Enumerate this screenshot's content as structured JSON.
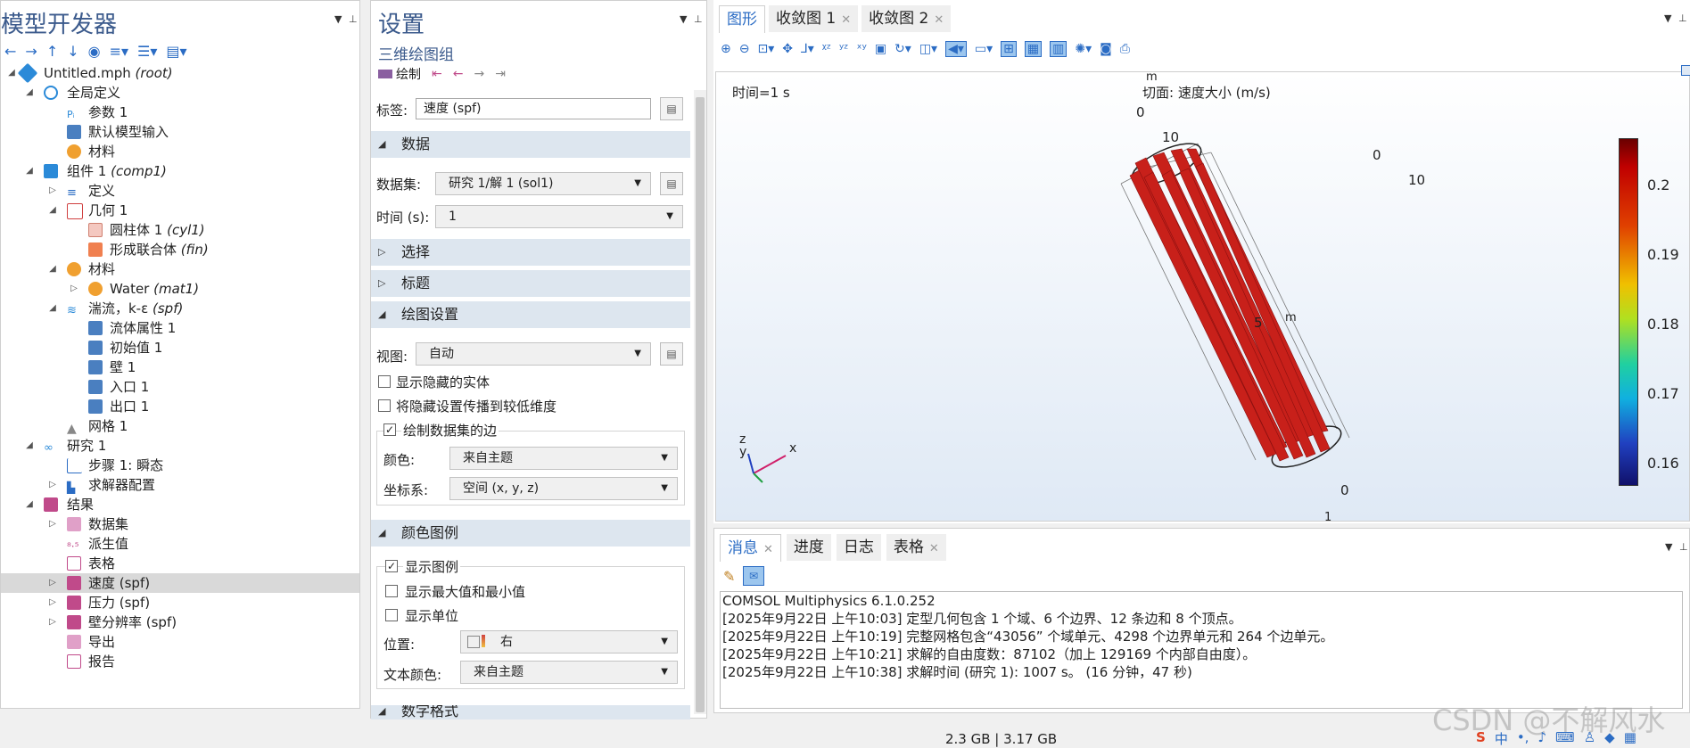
{
  "left_panel": {
    "title": "模型开发器",
    "tree": [
      {
        "label": "Untitled.mph",
        "tag": "(root)"
      },
      {
        "label": "全局定义",
        "tag": ""
      },
      {
        "label": "参数 1",
        "tag": ""
      },
      {
        "label": "默认模型输入",
        "tag": ""
      },
      {
        "label": "材料",
        "tag": ""
      },
      {
        "label": "组件 1",
        "tag": "(comp1)"
      },
      {
        "label": "定义",
        "tag": ""
      },
      {
        "label": "几何 1",
        "tag": ""
      },
      {
        "label": "圆柱体 1",
        "tag": "(cyl1)"
      },
      {
        "label": "形成联合体",
        "tag": "(fin)"
      },
      {
        "label": "材料",
        "tag": ""
      },
      {
        "label": "Water",
        "tag": "(mat1)"
      },
      {
        "label": "湍流，k-ε",
        "tag": "(spf)"
      },
      {
        "label": "流体属性 1",
        "tag": ""
      },
      {
        "label": "初始值 1",
        "tag": ""
      },
      {
        "label": "壁 1",
        "tag": ""
      },
      {
        "label": "入口 1",
        "tag": ""
      },
      {
        "label": "出口 1",
        "tag": ""
      },
      {
        "label": "网格 1",
        "tag": ""
      },
      {
        "label": "研究 1",
        "tag": ""
      },
      {
        "label": "步骤 1: 瞬态",
        "tag": ""
      },
      {
        "label": "求解器配置",
        "tag": ""
      },
      {
        "label": "结果",
        "tag": ""
      },
      {
        "label": "数据集",
        "tag": ""
      },
      {
        "label": "派生值",
        "tag": ""
      },
      {
        "label": "表格",
        "tag": ""
      },
      {
        "label": "速度 (spf)",
        "tag": ""
      },
      {
        "label": "压力 (spf)",
        "tag": ""
      },
      {
        "label": "壁分辨率 (spf)",
        "tag": ""
      },
      {
        "label": "导出",
        "tag": ""
      },
      {
        "label": "报告",
        "tag": ""
      }
    ]
  },
  "settings": {
    "title": "设置",
    "subtitle": "三维绘图组",
    "plot_label": "绘制",
    "label_caption": "标签:",
    "label_value": "速度 (spf)",
    "sections": {
      "data": "数据",
      "select": "选择",
      "heading": "标题",
      "plot_settings": "绘图设置",
      "color_legend": "颜色图例",
      "number_format": "数字格式"
    },
    "dataset_caption": "数据集:",
    "dataset_value": "研究 1/解 1 (sol1)",
    "time_caption": "时间 (s):",
    "time_value": "1",
    "view_caption": "视图:",
    "view_value": "自动",
    "show_hidden": "显示隐藏的实体",
    "propagate_hidden": "将隐藏设置传播到较低维度",
    "draw_edges": "绘制数据集的边",
    "color_caption": "颜色:",
    "color_value": "来自主题",
    "coord_caption": "坐标系:",
    "coord_value": "空间  (x, y, z)",
    "show_legend": "显示图例",
    "show_minmax": "显示最大值和最小值",
    "show_units": "显示单位",
    "position_caption": "位置:",
    "position_value": "右",
    "textcolor_caption": "文本颜色:",
    "textcolor_value": "来自主题"
  },
  "graphics": {
    "tabs": [
      "图形",
      "收敛图 1",
      "收敛图 2"
    ],
    "time_text": "时间=1 s",
    "slice_title": "切面: 速度大小 (m/s)",
    "unit_m": "m",
    "axis_labels": {
      "x": "x",
      "y": "y",
      "z": "z"
    },
    "tick_labels": [
      "0",
      "10",
      "5",
      "m",
      "0",
      "1"
    ],
    "colorbar": {
      "ticks": [
        "0.2",
        "0.19",
        "0.18",
        "0.17",
        "0.16"
      ],
      "colors": [
        "#c00000",
        "#e03000",
        "#ffd000",
        "#20d080",
        "#10b0e0",
        "#2040c0",
        "#10106a"
      ]
    }
  },
  "messages": {
    "tabs": [
      "消息",
      "进度",
      "日志",
      "表格"
    ],
    "lines": [
      "COMSOL Multiphysics 6.1.0.252",
      "[2025年9月22日 上午10:03] 定型几何包含 1 个域、6 个边界、12 条边和 8 个顶点。",
      "[2025年9月22日 上午10:19] 完整网格包含“43056” 个域单元、4298 个边界单元和 264 个边单元。",
      "[2025年9月22日 上午10:21] 求解的自由度数：87102（加上 129169 个内部自由度）。",
      "[2025年9月22日 上午10:38] 求解时间 (研究 1): 1007 s。  (16 分钟，47 秒)"
    ]
  },
  "status_bar": {
    "memory": "2.3 GB | 3.17 GB"
  },
  "watermark": "CSDN @不解风水",
  "tray": {
    "ime": "中"
  }
}
